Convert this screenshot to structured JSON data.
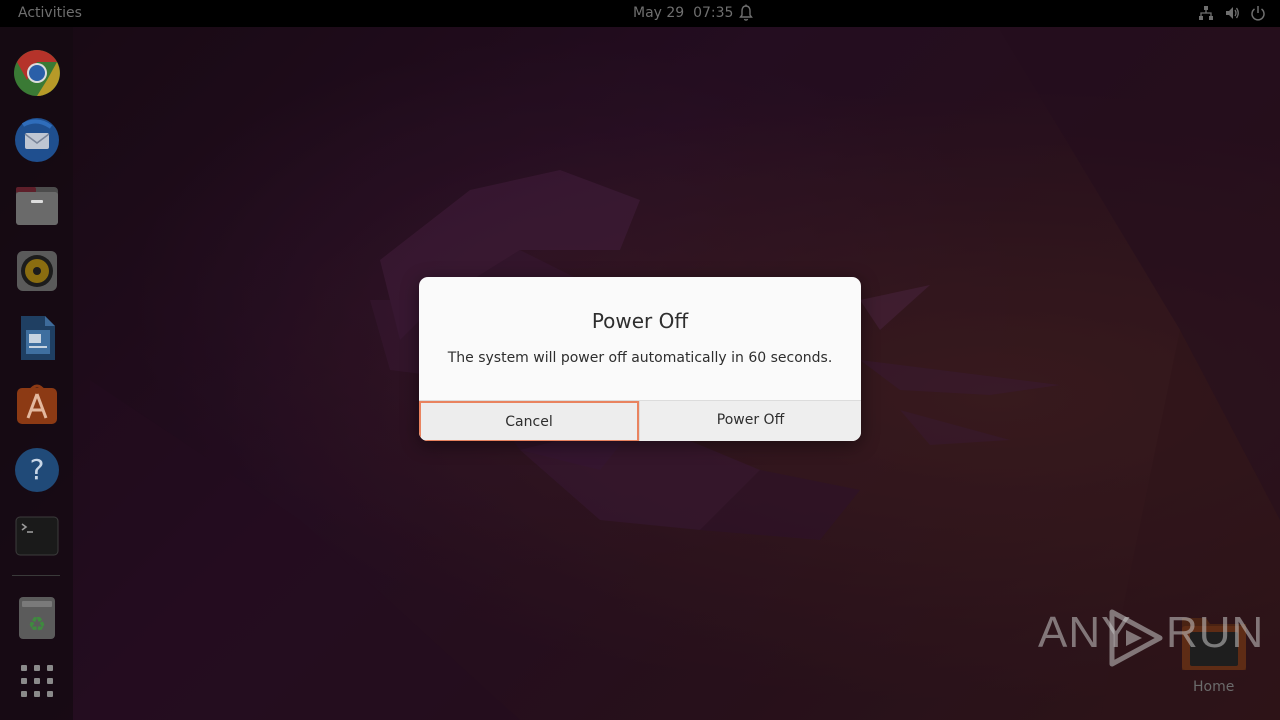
{
  "topbar": {
    "activities": "Activities",
    "clock": "May 29  07:35",
    "icons": [
      "bell-icon",
      "network-icon",
      "volume-icon",
      "power-icon"
    ]
  },
  "dock": {
    "items": [
      "chrome",
      "thunderbird",
      "files",
      "rhythmbox",
      "libreoffice-writer",
      "software-center",
      "help",
      "terminal",
      "trash",
      "show-apps"
    ]
  },
  "desktop": {
    "home_label": "Home",
    "watermark": {
      "left": "ANY",
      "right": "RUN"
    }
  },
  "dialog": {
    "title": "Power Off",
    "message": "The system will power off automatically in 60 seconds.",
    "cancel_label": "Cancel",
    "confirm_label": "Power Off"
  },
  "colors": {
    "focus_ring": "#e9835f",
    "topbar": "#000000",
    "dialog_bg": "#fafafa"
  }
}
